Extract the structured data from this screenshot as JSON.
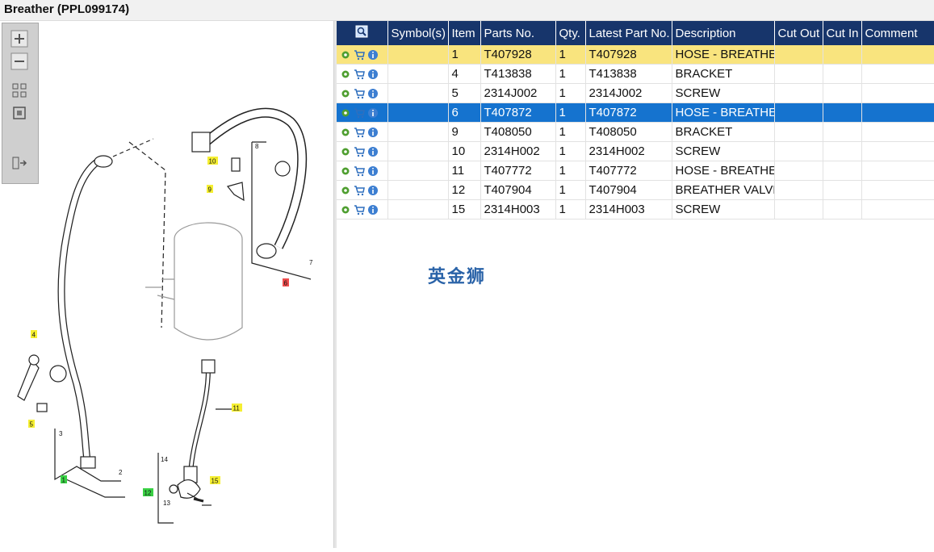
{
  "title": "Breather (PPL099174)",
  "columns": [
    "",
    "Symbol(s)",
    "Item",
    "Parts No.",
    "Qty.",
    "Latest Part No.",
    "Description",
    "Cut Out",
    "Cut In",
    "Comment"
  ],
  "rows": [
    {
      "item": "1",
      "part": "T407928",
      "qty": "1",
      "latest": "T407928",
      "desc": "HOSE - BREATHER",
      "highlight": "yellow"
    },
    {
      "item": "4",
      "part": "T413838",
      "qty": "1",
      "latest": "T413838",
      "desc": "BRACKET"
    },
    {
      "item": "5",
      "part": "2314J002",
      "qty": "1",
      "latest": "2314J002",
      "desc": "SCREW"
    },
    {
      "item": "6",
      "part": "T407872",
      "qty": "1",
      "latest": "T407872",
      "desc": "HOSE - BREATHER",
      "highlight": "blue"
    },
    {
      "item": "9",
      "part": "T408050",
      "qty": "1",
      "latest": "T408050",
      "desc": "BRACKET"
    },
    {
      "item": "10",
      "part": "2314H002",
      "qty": "1",
      "latest": "2314H002",
      "desc": "SCREW"
    },
    {
      "item": "11",
      "part": "T407772",
      "qty": "1",
      "latest": "T407772",
      "desc": "HOSE - BREATHER"
    },
    {
      "item": "12",
      "part": "T407904",
      "qty": "1",
      "latest": "T407904",
      "desc": "BREATHER VALVE"
    },
    {
      "item": "15",
      "part": "2314H003",
      "qty": "1",
      "latest": "2314H003",
      "desc": "SCREW"
    }
  ],
  "diagram_labels": {
    "l1": "1",
    "l2": "2",
    "l3": "3",
    "l4": "4",
    "l5": "5",
    "l6": "6",
    "l7": "7",
    "l8": "8",
    "l9": "9",
    "l10": "10",
    "l11": "11",
    "l12": "12",
    "l13": "13",
    "l14": "14",
    "l15": "15"
  },
  "watermark": "英金狮",
  "colors": {
    "header": "#17356b",
    "selected": "#1573cf",
    "highlight": "#f9e47e"
  }
}
